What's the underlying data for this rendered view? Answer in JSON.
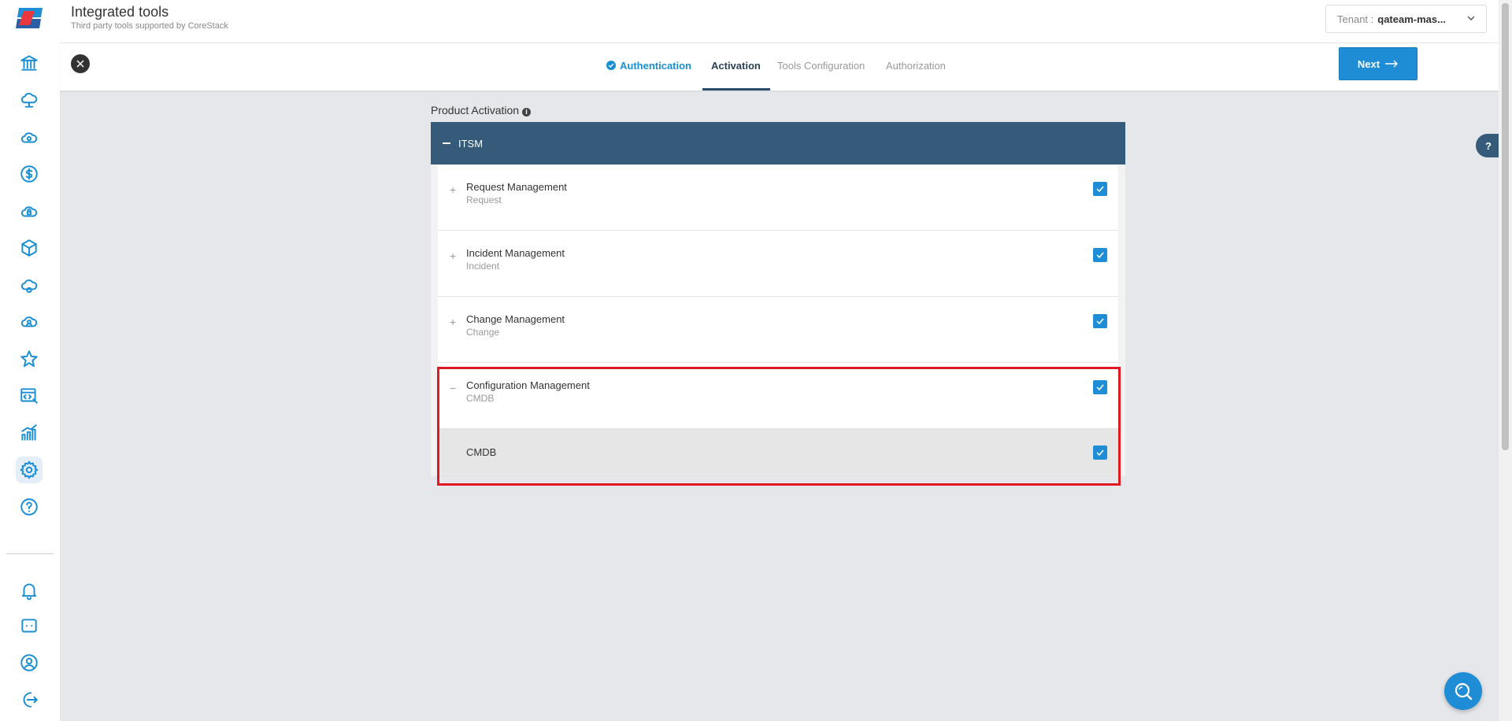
{
  "header": {
    "title": "Integrated tools",
    "subtitle": "Third party tools supported by CoreStack",
    "tenant_label": "Tenant :",
    "tenant_value": "qateam-mas..."
  },
  "wizard": {
    "tabs": [
      {
        "label": "Authentication",
        "state": "completed"
      },
      {
        "label": "Activation",
        "state": "active"
      },
      {
        "label": "Tools Configuration",
        "state": "pending"
      },
      {
        "label": "Authorization",
        "state": "pending"
      }
    ],
    "next_label": "Next"
  },
  "main": {
    "section_title": "Product Activation",
    "panel": {
      "title": "ITSM",
      "rows": [
        {
          "title": "Request Management",
          "subtitle": "Request",
          "checked": true,
          "toggle": "+"
        },
        {
          "title": "Incident Management",
          "subtitle": "Incident",
          "checked": true,
          "toggle": "+"
        },
        {
          "title": "Change Management",
          "subtitle": "Change",
          "checked": true,
          "toggle": "+"
        },
        {
          "title": "Configuration Management",
          "subtitle": "CMDB",
          "checked": true,
          "toggle": "−"
        },
        {
          "title": "CMDB",
          "checked": true
        }
      ]
    }
  },
  "help_label": "?",
  "colors": {
    "accent": "#1f8dd6",
    "panel_header": "#355a7a",
    "highlight": "#e11a22"
  }
}
